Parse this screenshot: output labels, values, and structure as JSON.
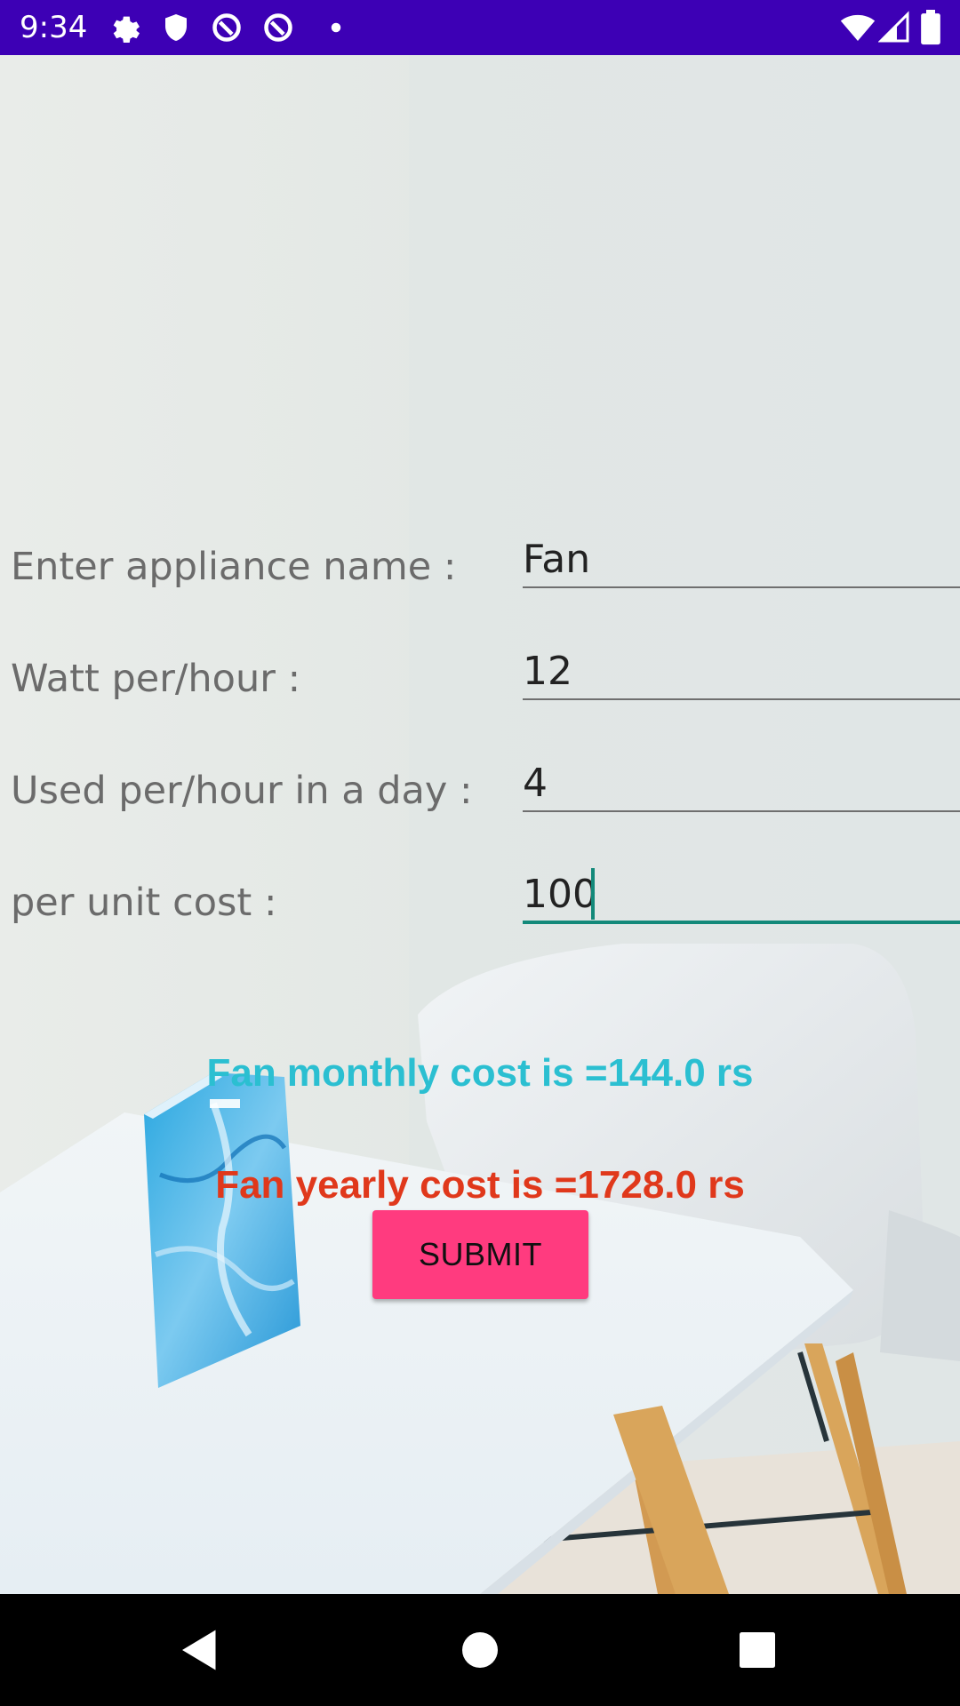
{
  "status_bar": {
    "time": "9:34",
    "left_icons": [
      "settings-gear-icon",
      "shield-icon",
      "data-saver-icon",
      "data-saver-icon",
      "notification-dot-icon"
    ],
    "right_icons": [
      "wifi-icon",
      "cellular-signal-icon",
      "battery-icon"
    ],
    "background_color": "#3d00b5"
  },
  "form": {
    "appliance_name": {
      "label": "Enter appliance name :",
      "value": "Fan"
    },
    "watt_per_hour": {
      "label": "Watt per/hour :",
      "value": "12"
    },
    "hours_per_day": {
      "label": "Used per/hour in a day :",
      "value": "4"
    },
    "unit_cost": {
      "label": "per unit cost :",
      "value": "100"
    }
  },
  "results": {
    "monthly": "Fan monthly cost is =144.0 rs",
    "yearly": "Fan yearly cost is =1728.0 rs"
  },
  "submit_button": {
    "label": "SUBMIT",
    "color": "#ff3b7f"
  },
  "colors": {
    "monthly_text": "#2bbfd1",
    "yearly_text": "#e0381b",
    "focus_accent": "#13897a"
  },
  "nav_bar": {
    "buttons": [
      "back-icon",
      "home-icon",
      "recents-icon"
    ]
  }
}
